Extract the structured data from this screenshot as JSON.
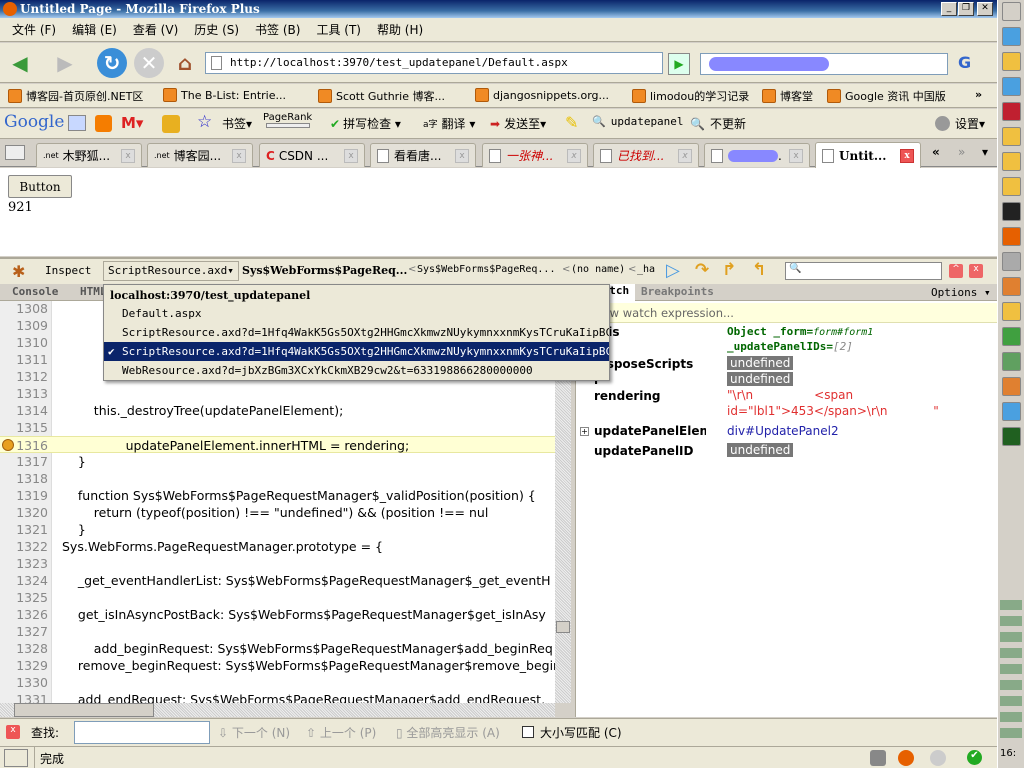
{
  "window": {
    "title": "Untitled Page - Mozilla Firefox Plus",
    "controls": [
      "_",
      "❐",
      "✕"
    ]
  },
  "menu": [
    "文件 (F)",
    "编辑 (E)",
    "查看 (V)",
    "历史 (S)",
    "书签 (B)",
    "工具 (T)",
    "帮助 (H)"
  ],
  "nav": {
    "url": "http://localhost:3970/test_updatepanel/Default.aspx",
    "search_engine": "G"
  },
  "bookmarks": [
    "博客园-首页原创.NET区",
    "The B-List: Entrie...",
    "Scott Guthrie 博客...",
    "djangosnippets.org...",
    "limodou的学习记录",
    "博客堂",
    "Google 资讯 中国版"
  ],
  "bookmarks_more": "»",
  "google_toolbar": {
    "logo": "Google",
    "bookmarks": "书签",
    "pagerank": "PageRank",
    "spell": "拼写检查",
    "translate": "翻译",
    "send": "发送至",
    "search1": "updatepanel",
    "search2": "不更新",
    "settings": "设置"
  },
  "tabs": [
    {
      "label": "木野狐...",
      "icon": ".net"
    },
    {
      "label": "博客园...",
      "icon": ".net"
    },
    {
      "label": "CSDN ...",
      "icon": "C"
    },
    {
      "label": "看看唐..."
    },
    {
      "label": "一张神...",
      "red": true
    },
    {
      "label": "已找到...",
      "red": true
    },
    {
      "label": "."
    },
    {
      "label": "Untit...",
      "active": true
    }
  ],
  "tab_nav": [
    "«",
    "»",
    "▾"
  ],
  "page": {
    "button_label": "Button",
    "label_value": "921"
  },
  "firebug": {
    "inspect": "Inspect",
    "script_select": "ScriptResource.axd▾",
    "stack": [
      "Sys$WebForms$PageReq...",
      "Sys$WebForms$PageReq...",
      "(no name)",
      "_ha"
    ],
    "tabs": [
      "Console",
      "HTML"
    ],
    "side_tabs": [
      "Watch",
      "Breakpoints"
    ],
    "options": "Options ▾",
    "dropdown": {
      "header": "localhost:3970/test_updatepanel",
      "items": [
        "Default.aspx",
        "ScriptResource.axd?d=1Hfq4WakK5Gs5OXtg2HHGmcXkmwzNUykymnxxnmKysTCruKaIipBC...",
        "ScriptResource.axd?d=1Hfq4WakK5Gs5OXtg2HHGmcXkmwzNUykymnxxnmKysTCruKaIipBC...",
        "WebResource.axd?d=jbXzBGm3XCxYkCkmXB29cw2&t=633198866280000000"
      ],
      "selected": 2
    },
    "code": [
      {
        "n": "1308",
        "t": ""
      },
      {
        "n": "1309",
        "t": ""
      },
      {
        "n": "1310",
        "t": ""
      },
      {
        "n": "1311",
        "t": ""
      },
      {
        "n": "1312",
        "t": ""
      },
      {
        "n": "1313",
        "t": ""
      },
      {
        "n": "1314",
        "t": "        this._destroyTree(updatePanelElement);"
      },
      {
        "n": "1315",
        "t": ""
      },
      {
        "n": "1316",
        "t": "                updatePanelElement.innerHTML = rendering;"
      },
      {
        "n": "1317",
        "t": "    }"
      },
      {
        "n": "1318",
        "t": ""
      },
      {
        "n": "1319",
        "t": "    function Sys$WebForms$PageRequestManager$_validPosition(position) {"
      },
      {
        "n": "1320",
        "t": "        return (typeof(position) !== \"undefined\") && (position !== nul"
      },
      {
        "n": "1321",
        "t": "    }"
      },
      {
        "n": "1322",
        "t": "Sys.WebForms.PageRequestManager.prototype = {"
      },
      {
        "n": "1323",
        "t": ""
      },
      {
        "n": "1324",
        "t": "    _get_eventHandlerList: Sys$WebForms$PageRequestManager$_get_eventH"
      },
      {
        "n": "1325",
        "t": ""
      },
      {
        "n": "1326",
        "t": "    get_isInAsyncPostBack: Sys$WebForms$PageRequestManager$get_isInAsy"
      },
      {
        "n": "1327",
        "t": ""
      },
      {
        "n": "1328",
        "t": "        add_beginRequest: Sys$WebForms$PageRequestManager$add_beginReq"
      },
      {
        "n": "1329",
        "t": "    remove_beginRequest: Sys$WebForms$PageRequestManager$remove_beginR"
      },
      {
        "n": "1330",
        "t": ""
      },
      {
        "n": "1331",
        "t": "    add_endRequest: Sys$WebForms$PageRequestManager$add_endRequest,"
      }
    ],
    "current_line": "1316",
    "watch_placeholder": "New watch expression...",
    "watch": [
      {
        "name": "this",
        "v1": "Object _form=",
        "v1i": "form#form1",
        "v2": "_updatePanelIDs=",
        "v2i": "[2]"
      },
      {
        "name": "disposeScripts",
        "value": "undefined"
      },
      {
        "name": "i",
        "value": "undefined"
      },
      {
        "name": "rendering",
        "value": "\"\\r\\n                <span",
        "value2": "id=\"lbl1\">453</span>\\r\\n            \""
      },
      {
        "name": "updatePanelElement",
        "value": "div#UpdatePanel2",
        "expandable": "+"
      },
      {
        "name": "updatePanelID",
        "value": "undefined"
      }
    ]
  },
  "findbar": {
    "label": "查找:",
    "next": "下一个 (N)",
    "prev": "上一个 (P)",
    "highlight": "全部高亮显示 (A)",
    "match_case": "大小写匹配 (C)"
  },
  "status": {
    "text": "完成",
    "clock": "16:"
  }
}
